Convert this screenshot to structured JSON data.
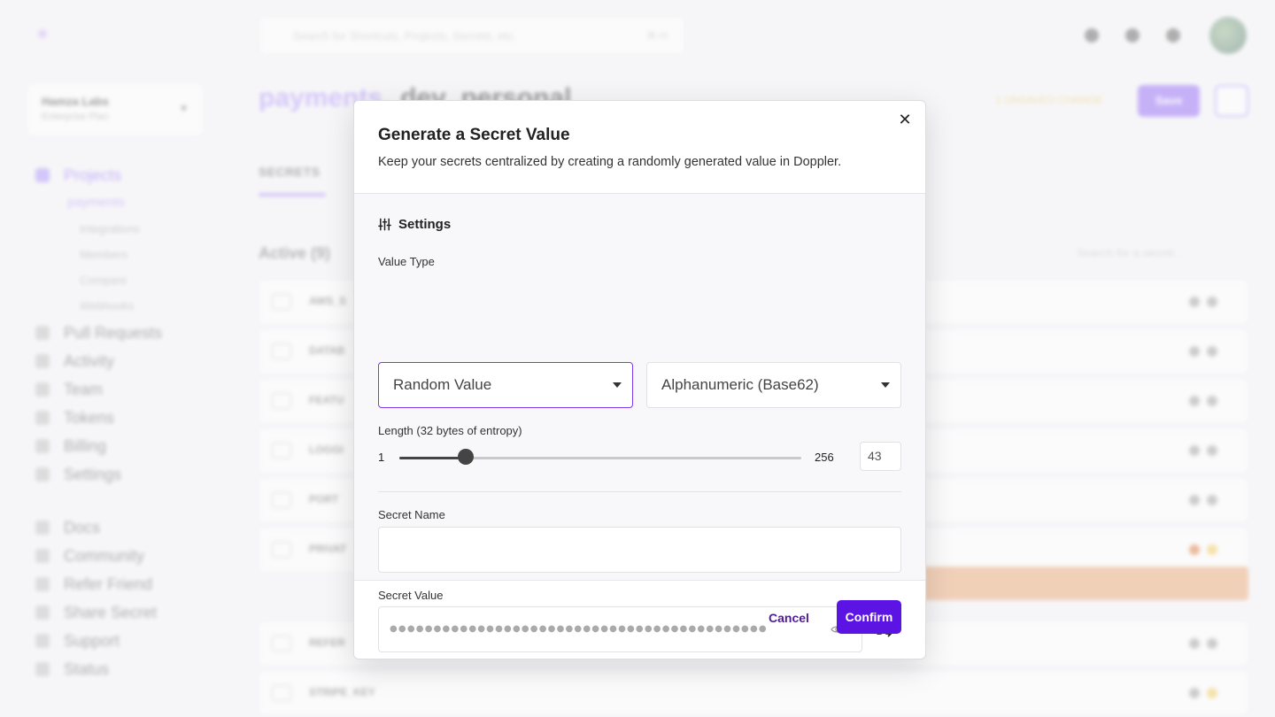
{
  "background": {
    "search_placeholder": "Search for Shortcuts, Projects, Secrets, etc.",
    "search_shortcut": "⌘+K",
    "workspace_name": "Hamza Labs",
    "workspace_plan": "Enterprise Plan",
    "nav_items": [
      {
        "label": "Projects",
        "icon": "projects-icon",
        "active": true
      },
      {
        "label": "Pull Requests",
        "icon": "pull-request-icon"
      },
      {
        "label": "Activity",
        "icon": "activity-icon"
      },
      {
        "label": "Team",
        "icon": "team-icon"
      },
      {
        "label": "Tokens",
        "icon": "key-icon"
      },
      {
        "label": "Billing",
        "icon": "billing-icon"
      },
      {
        "label": "Settings",
        "icon": "gear-icon"
      }
    ],
    "nav_project": "payments",
    "nav_project_subitems": [
      "Integrations",
      "Members",
      "Compare",
      "Webhooks"
    ],
    "nav_secondary": [
      {
        "label": "Docs",
        "icon": "docs-icon"
      },
      {
        "label": "Community",
        "icon": "community-icon"
      },
      {
        "label": "Refer Friend",
        "icon": "gift-icon"
      },
      {
        "label": "Share Secret",
        "icon": "share-icon"
      },
      {
        "label": "Support",
        "icon": "support-icon"
      },
      {
        "label": "Status",
        "icon": "status-icon"
      }
    ],
    "breadcrumb_project": "payments",
    "breadcrumb_env": "dev_personal",
    "unsaved_label": "1 UNSAVED CHANGE",
    "save_label": "Save",
    "tab_secrets": "SECRETS",
    "active_heading": "Active (9)",
    "secret_search_placeholder": "Search for a secret...",
    "secret_rows": [
      "AWS_S",
      "DATAB",
      "FEATU",
      "LOGGI",
      "PORT",
      "PRIVAT",
      "REFER",
      "STRIPE_KEY"
    ],
    "accent_color": "#7c3aed"
  },
  "modal": {
    "title": "Generate a Secret Value",
    "subtitle": "Keep your secrets centralized by creating a randomly generated value in Doppler.",
    "close_icon": "close-icon",
    "settings_heading": "Settings",
    "settings_icon": "sliders-icon",
    "value_type_label": "Value Type",
    "value_type_selected": "Random Value",
    "encoding_selected": "Alphanumeric (Base62)",
    "length_label": "Length (32 bytes of entropy)",
    "length_min": "1",
    "length_max": "256",
    "length_value": "43",
    "length_fraction": 0.165,
    "secret_name_label": "Secret Name",
    "secret_name_value": "",
    "secret_value_label": "Secret Value",
    "secret_value_masked": "●●●●●●●●●●●●●●●●●●●●●●●●●●●●●●●●●●●●●●●●●●●",
    "reveal_icon": "eye-icon",
    "regenerate_icon": "shuffle-icon",
    "cancel_label": "Cancel",
    "confirm_label": "Confirm",
    "confirm_color": "#5b14e4"
  }
}
